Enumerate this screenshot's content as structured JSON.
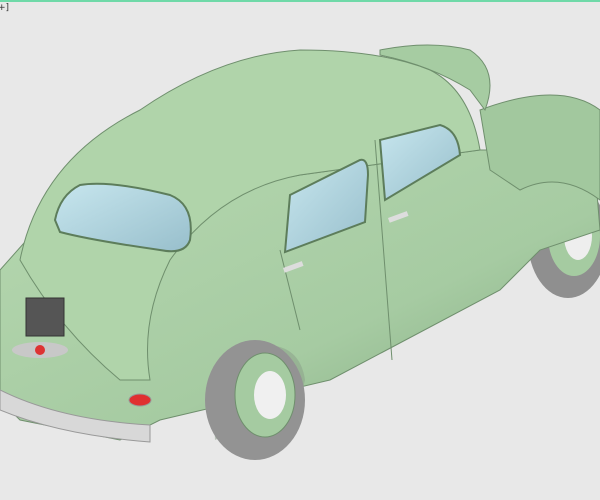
{
  "viewport": {
    "label": "+]",
    "model": "car-3d-model",
    "colors": {
      "body": "#a8cda4",
      "glass": "#a9d3df",
      "tire": "#9a9a9a",
      "bumper": "#d8d8d8",
      "background": "#e8e8e8",
      "accent": "#6fd9a8"
    }
  }
}
